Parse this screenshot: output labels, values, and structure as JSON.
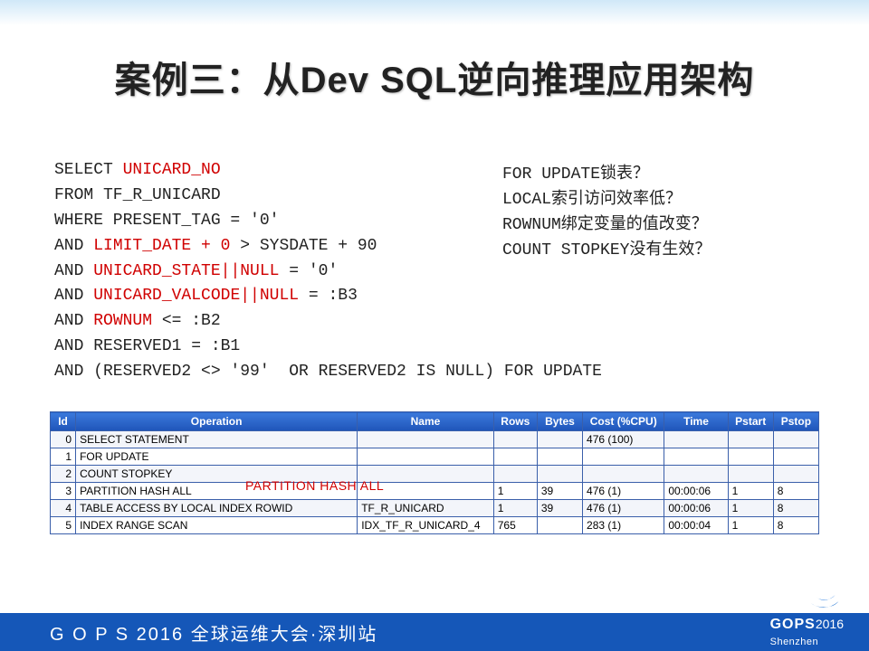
{
  "title": "案例三：从Dev SQL逆向推理应用架构",
  "sql": {
    "l1a": "SELECT ",
    "l1b": "UNICARD_NO",
    "l2": "FROM TF_R_UNICARD",
    "l3": "WHERE PRESENT_TAG = '0'",
    "l4a": "AND ",
    "l4b": "LIMIT_DATE + 0",
    "l4c": " > SYSDATE + 90",
    "l5a": "AND ",
    "l5b": "UNICARD_STATE||NULL",
    "l5c": " = '0'",
    "l6a": "AND ",
    "l6b": "UNICARD_VALCODE||NULL",
    "l6c": " = :B3",
    "l7a": "AND ",
    "l7b": "ROWNUM",
    "l7c": " <= :B2",
    "l8": "AND RESERVED1 = :B1",
    "l9": "AND (RESERVED2 <> '99'  OR RESERVED2 IS NULL) FOR UPDATE"
  },
  "notes": {
    "n1": "FOR UPDATE锁表？",
    "n2": "LOCAL索引访问效率低？",
    "n3": "ROWNUM绑定变量的值改变？",
    "n4": "COUNT STOPKEY没有生效？"
  },
  "plan": {
    "headers": [
      "Id",
      "Operation",
      "Name",
      "Rows",
      "Bytes",
      "Cost (%CPU)",
      "Time",
      "Pstart",
      "Pstop"
    ],
    "rows": [
      {
        "id": "0",
        "op": "SELECT STATEMENT",
        "name": "",
        "rows": "",
        "bytes": "",
        "cost": "476 (100)",
        "time": "",
        "pstart": "",
        "pstop": ""
      },
      {
        "id": "1",
        "op": "  FOR UPDATE",
        "name": "",
        "rows": "",
        "bytes": "",
        "cost": "",
        "time": "",
        "pstart": "",
        "pstop": ""
      },
      {
        "id": "2",
        "op": "    COUNT STOPKEY",
        "name": "",
        "rows": "",
        "bytes": "",
        "cost": "",
        "time": "",
        "pstart": "",
        "pstop": ""
      },
      {
        "id": "3",
        "op": "      PARTITION HASH ALL",
        "name": "",
        "rows": "1",
        "bytes": "39",
        "cost": "476 (1)",
        "time": "00:00:06",
        "pstart": "1",
        "pstop": "8"
      },
      {
        "id": "4",
        "op": "        TABLE ACCESS BY LOCAL INDEX ROWID",
        "name": "TF_R_UNICARD",
        "rows": "1",
        "bytes": "39",
        "cost": "476 (1)",
        "time": "00:00:06",
        "pstart": "1",
        "pstop": "8"
      },
      {
        "id": "5",
        "op": "          INDEX RANGE SCAN",
        "name": "IDX_TF_R_UNICARD_4",
        "rows": "765",
        "bytes": "",
        "cost": "283 (1)",
        "time": "00:00:04",
        "pstart": "1",
        "pstop": "8"
      }
    ]
  },
  "annotation": "PARTITION HASH ALL",
  "footer": {
    "text": "G O P S 2016 全球运维大会·深圳站",
    "brand": "GOPS",
    "year": "2016",
    "city": "Shenzhen"
  },
  "chart_data": {
    "type": "table",
    "title": "SQL Execution Plan",
    "columns": [
      "Id",
      "Operation",
      "Name",
      "Rows",
      "Bytes",
      "Cost (%CPU)",
      "Time",
      "Pstart",
      "Pstop"
    ],
    "data": [
      [
        0,
        "SELECT STATEMENT",
        "",
        "",
        "",
        "476 (100)",
        "",
        "",
        ""
      ],
      [
        1,
        "FOR UPDATE",
        "",
        "",
        "",
        "",
        "",
        "",
        ""
      ],
      [
        2,
        "COUNT STOPKEY",
        "",
        "",
        "",
        "",
        "",
        "",
        ""
      ],
      [
        3,
        "PARTITION HASH ALL",
        "",
        1,
        39,
        "476 (1)",
        "00:00:06",
        1,
        8
      ],
      [
        4,
        "TABLE ACCESS BY LOCAL INDEX ROWID",
        "TF_R_UNICARD",
        1,
        39,
        "476 (1)",
        "00:00:06",
        1,
        8
      ],
      [
        5,
        "INDEX RANGE SCAN",
        "IDX_TF_R_UNICARD_4",
        765,
        "",
        "283 (1)",
        "00:00:04",
        1,
        8
      ]
    ]
  }
}
